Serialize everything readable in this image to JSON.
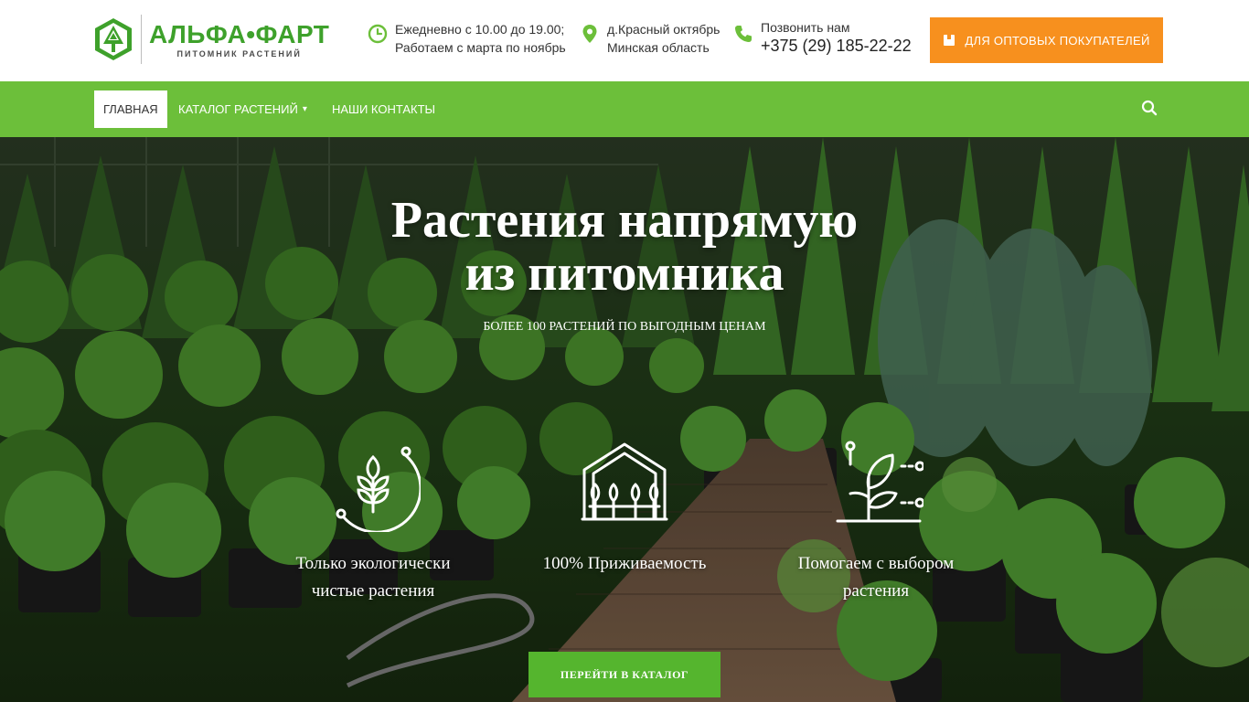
{
  "logo": {
    "title": "АЛЬФА•ФАРТ",
    "subtitle": "ПИТОМНИК РАСТЕНИЙ"
  },
  "header": {
    "hours_line1": "Ежедневно с 10.00 до 19.00;",
    "hours_line2": "Работаем с марта по ноябрь",
    "address_line1": "д.Красный октябрь",
    "address_line2": "Минская область",
    "phone_label": "Позвонить нам",
    "phone_number": "+375 (29) 185-22-22",
    "wholesale_label": "ДЛЯ ОПТОВЫХ ПОКУПАТЕЛЕЙ"
  },
  "nav": {
    "items": [
      {
        "label": "ГЛАВНАЯ"
      },
      {
        "label": "КАТАЛОГ РАСТЕНИЙ"
      },
      {
        "label": "НАШИ КОНТАКТЫ"
      }
    ],
    "catalog_chevron": "▾"
  },
  "hero": {
    "title_line1": "Растения напрямую",
    "title_line2": "из питомника",
    "subtitle": "БОЛЕЕ 100 РАСТЕНИЙ ПО ВЫГОДНЫМ ЦЕНАМ",
    "features": [
      {
        "icon": "wheat-icon",
        "line1": "Только экологически",
        "line2": "чистые растения"
      },
      {
        "icon": "greenhouse-icon",
        "line1": "100% Приживаемость",
        "line2": ""
      },
      {
        "icon": "sprout-icon",
        "line1": "Помогаем с выбором",
        "line2": "растения"
      }
    ],
    "cta_label": "ПЕРЕЙТИ В КАТАЛОГ"
  },
  "colors": {
    "brand_green": "#3ea12b",
    "nav_green": "#6cbf3a",
    "cta_green": "#55b52e",
    "orange": "#f7901e"
  }
}
